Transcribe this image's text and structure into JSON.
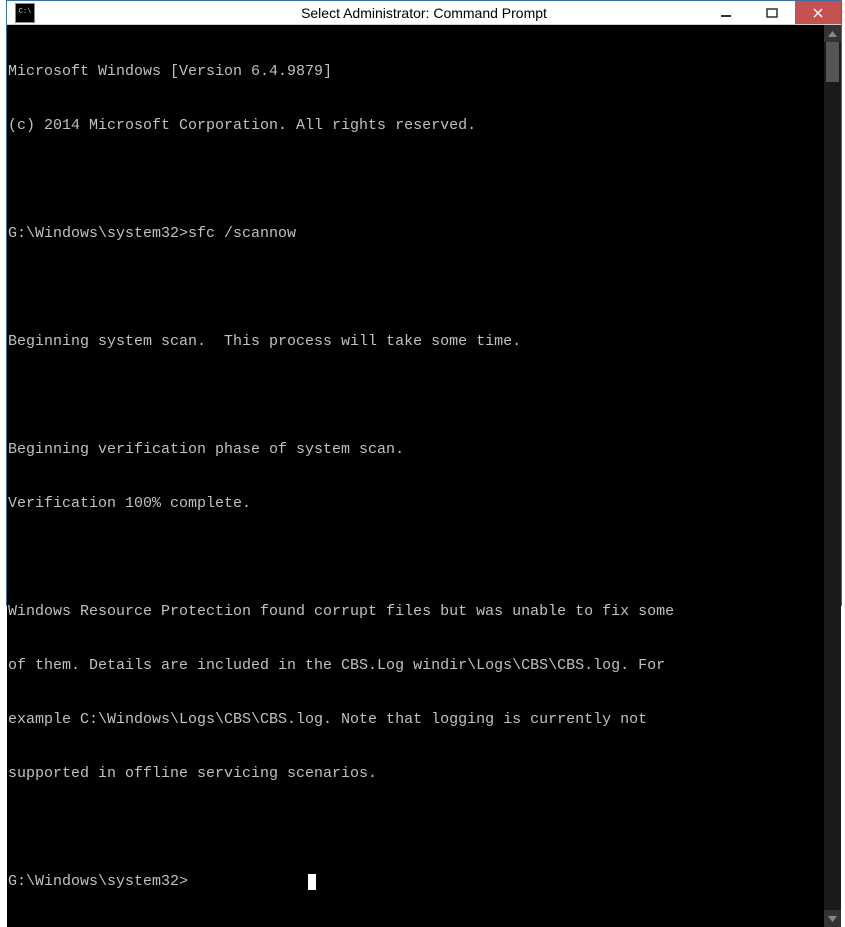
{
  "window": {
    "title": "Select Administrator: Command Prompt"
  },
  "terminal": {
    "lines": [
      "Microsoft Windows [Version 6.4.9879]",
      "(c) 2014 Microsoft Corporation. All rights reserved.",
      "",
      "G:\\Windows\\system32>sfc /scannow",
      "",
      "Beginning system scan.  This process will take some time.",
      "",
      "Beginning verification phase of system scan.",
      "Verification 100% complete.",
      "",
      "Windows Resource Protection found corrupt files but was unable to fix some",
      "of them. Details are included in the CBS.Log windir\\Logs\\CBS\\CBS.log. For",
      "example C:\\Windows\\Logs\\CBS\\CBS.log. Note that logging is currently not",
      "supported in offline servicing scenarios.",
      ""
    ],
    "prompt": "G:\\Windows\\system32>"
  }
}
